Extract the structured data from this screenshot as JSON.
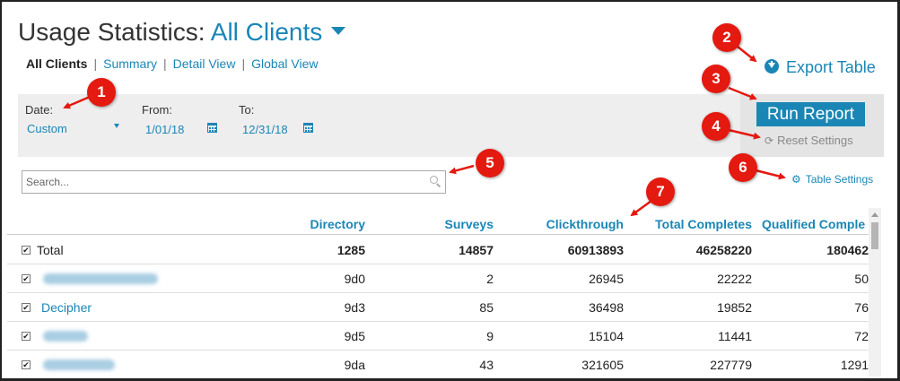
{
  "header": {
    "title_prefix": "Usage Statistics:",
    "client_selector": "All Clients"
  },
  "subnav": [
    {
      "label": "All Clients",
      "active": true
    },
    {
      "label": "Summary"
    },
    {
      "label": "Detail View"
    },
    {
      "label": "Global View"
    }
  ],
  "export_label": "Export Table",
  "filters": {
    "date_label": "Date:",
    "date_value": "Custom",
    "from_label": "From:",
    "from_value": "1/01/18",
    "to_label": "To:",
    "to_value": "12/31/18"
  },
  "run_report_label": "Run Report",
  "reset_settings_label": "Reset Settings",
  "search": {
    "placeholder": "Search..."
  },
  "table_settings_label": "Table Settings",
  "table": {
    "columns": [
      "Directory",
      "Surveys",
      "Clickthrough",
      "Total Completes",
      "Qualified Comple"
    ],
    "total": {
      "name": "Total",
      "directory": "1285",
      "surveys": "14857",
      "clickthrough": "60913893",
      "total_completes": "46258220",
      "qualified": "180462"
    },
    "rows": [
      {
        "name": "",
        "directory": "9d0",
        "surveys": "2",
        "clickthrough": "26945",
        "total_completes": "22222",
        "qualified": "50"
      },
      {
        "name": "Decipher",
        "directory": "9d3",
        "surveys": "85",
        "clickthrough": "36498",
        "total_completes": "19852",
        "qualified": "76"
      },
      {
        "name": "",
        "directory": "9d5",
        "surveys": "9",
        "clickthrough": "15104",
        "total_completes": "11441",
        "qualified": "72"
      },
      {
        "name": "",
        "directory": "9da",
        "surveys": "43",
        "clickthrough": "321605",
        "total_completes": "227779",
        "qualified": "1291"
      }
    ]
  },
  "callouts": [
    "1",
    "2",
    "3",
    "4",
    "5",
    "6",
    "7"
  ],
  "colors": {
    "accent": "#1a86b5",
    "callout": "#e4190f",
    "panel": "#eeeeee"
  }
}
